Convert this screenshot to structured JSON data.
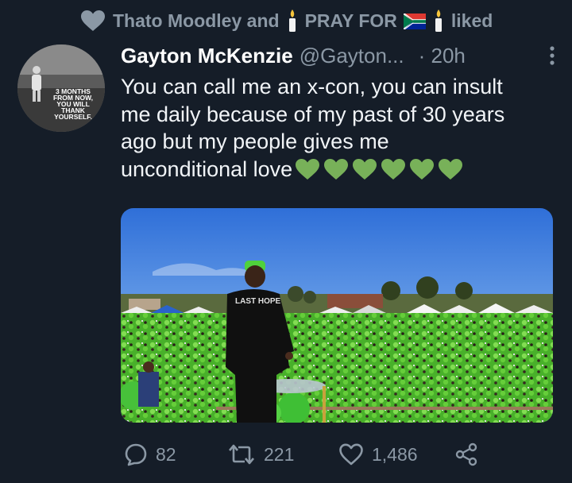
{
  "social_context": {
    "names": "Thato Moodley and",
    "pray_for": "PRAY FOR",
    "liked": "liked"
  },
  "avatar": {
    "caption_lines": [
      "3 MONTHS",
      "FROM NOW,",
      "YOU WILL",
      "THANK",
      "YOURSELF."
    ]
  },
  "tweet": {
    "display_name": "Gayton McKenzie",
    "handle": "@Gayton...",
    "time": "· 20h",
    "text_lines": [
      "You can call me an x-con, you can insult",
      "me daily because of my past of 30 years",
      "ago but my people gives me",
      "unconditional love"
    ],
    "emoji": "green-heart x6"
  },
  "media": {
    "shirt_text": "LAST HOPE"
  },
  "actions": {
    "replies": "82",
    "retweets": "221",
    "likes": "1,486"
  },
  "colors": {
    "background": "#151d28",
    "muted": "#8b98a5",
    "text": "#f1f4f7",
    "heart_green": "#78b159",
    "crowd_green": "#5fd43a"
  }
}
